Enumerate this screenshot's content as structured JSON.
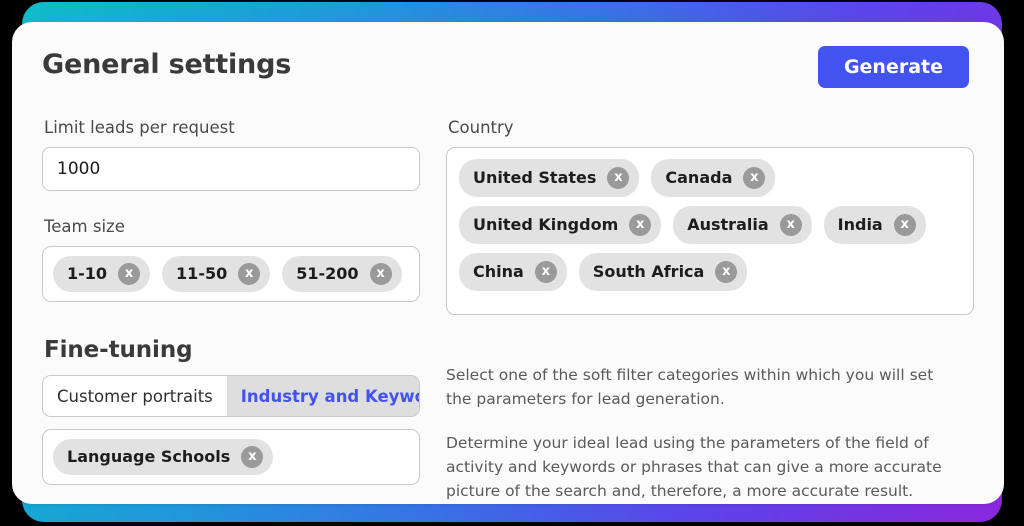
{
  "header": {
    "title": "General settings",
    "generate_label": "Generate"
  },
  "general": {
    "limit_label": "Limit leads per request",
    "limit_value": "1000",
    "limit_placeholder": "1000",
    "team_size_label": "Team size",
    "team_size_chips": [
      {
        "label": "1-10",
        "remove": "x"
      },
      {
        "label": "11-50",
        "remove": "x"
      },
      {
        "label": "51-200",
        "remove": "x"
      }
    ],
    "country_label": "Country",
    "country_chips": [
      {
        "label": "United States",
        "remove": "x"
      },
      {
        "label": "Canada",
        "remove": "x"
      },
      {
        "label": "United Kingdom",
        "remove": "x"
      },
      {
        "label": "Australia",
        "remove": "x"
      },
      {
        "label": "India",
        "remove": "x"
      },
      {
        "label": "China",
        "remove": "x"
      },
      {
        "label": "South Africa",
        "remove": "x"
      }
    ]
  },
  "fine_tuning": {
    "title": "Fine-tuning",
    "tabs": [
      {
        "label": "Customer portraits",
        "active": false
      },
      {
        "label": "Industry and Keywords",
        "active": true
      }
    ],
    "keyword_chips": [
      {
        "label": "Language Schools",
        "remove": "x"
      }
    ],
    "description": [
      "Select one of the soft filter categories within which you will set the parameters for lead generation.",
      "Determine your ideal lead using the parameters of the field of activity and keywords or phrases that can give a more accurate picture of the search and, therefore, a more accurate result."
    ]
  },
  "colors": {
    "accent_blue": "#4353F0",
    "gradient_start": "#0FBCC8",
    "gradient_mid": "#2196DB",
    "gradient_end": "#8A28DC",
    "chip_bg": "#E2E2E2",
    "chip_remove_bg": "#9A9A9A",
    "active_tab_bg": "#DEDEDE"
  }
}
